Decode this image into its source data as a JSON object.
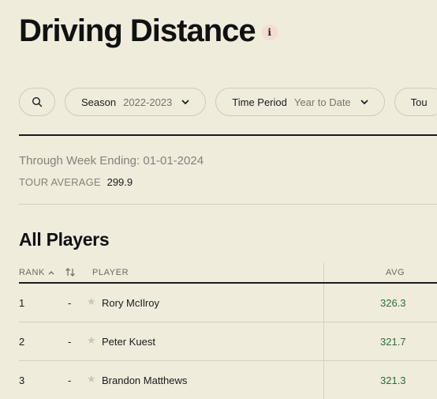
{
  "page": {
    "title": "Driving Distance",
    "info_label": "i"
  },
  "filters": {
    "season_label": "Season",
    "season_value": "2022-2023",
    "time_period_label": "Time Period",
    "time_period_value": "Year to Date",
    "tour_label_partial": "Tou"
  },
  "summary": {
    "week_ending": "Through Week Ending: 01-01-2024",
    "tour_average_label": "TOUR AVERAGE",
    "tour_average_value": "299.9"
  },
  "section": {
    "title": "All Players"
  },
  "table": {
    "headers": {
      "rank": "RANK",
      "player": "PLAYER",
      "avg": "AVG"
    },
    "rows": [
      {
        "rank": "1",
        "movement": "-",
        "player": "Rory McIlroy",
        "avg": "326.3"
      },
      {
        "rank": "2",
        "movement": "-",
        "player": "Peter Kuest",
        "avg": "321.7"
      },
      {
        "rank": "3",
        "movement": "-",
        "player": "Brandon Matthews",
        "avg": "321.3"
      }
    ]
  },
  "colors": {
    "background": "#f0ecdc",
    "avg_value": "#2f6b3d",
    "star": "#cbc5b2"
  }
}
